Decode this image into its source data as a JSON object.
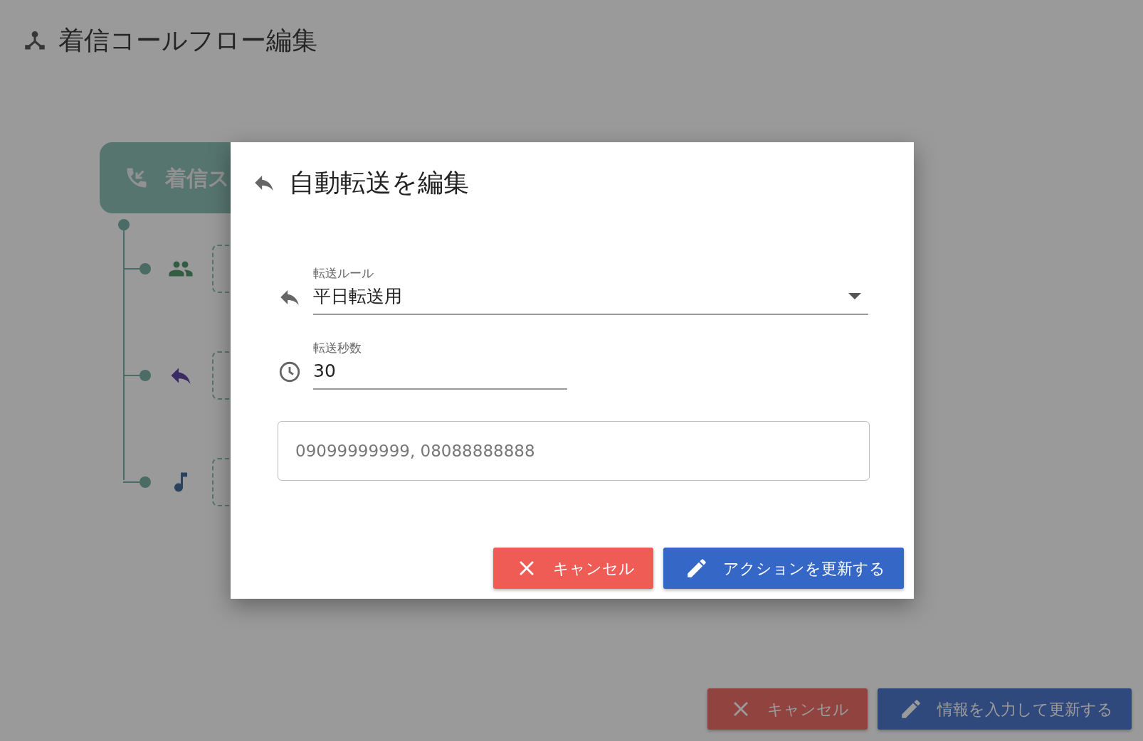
{
  "page": {
    "title": "着信コールフロー編集"
  },
  "flow": {
    "start": {
      "label": "着信ス"
    },
    "steps": [
      {
        "kind": "group"
      },
      {
        "kind": "forward"
      },
      {
        "kind": "audio"
      }
    ]
  },
  "footer_buttons": [
    {
      "kind": "cancel",
      "label": "キャンセル"
    },
    {
      "kind": "update",
      "label": "情報を入力して更新する"
    }
  ],
  "dialog": {
    "title": "自動転送を編集",
    "fields": [
      {
        "kind": "select",
        "label": "転送ルール",
        "value": "平日転送用"
      },
      {
        "kind": "number",
        "label": "転送秒数",
        "value": "30"
      },
      {
        "kind": "outlined",
        "placeholder": "09099999999, 08088888888"
      }
    ],
    "buttons": [
      {
        "kind": "cancel",
        "label": "キャンセル"
      },
      {
        "kind": "update",
        "label": "アクションを更新する"
      }
    ]
  }
}
